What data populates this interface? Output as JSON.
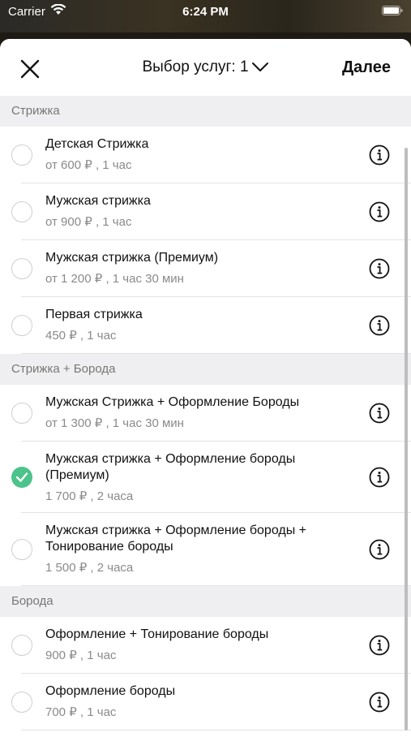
{
  "status_bar": {
    "carrier": "Carrier",
    "time": "6:24 PM"
  },
  "navbar": {
    "title": "Выбор услуг: 1",
    "next_label": "Далее"
  },
  "icons": {
    "close": "close-icon",
    "chevron": "chevron-down-icon",
    "info": "info-icon",
    "check": "checkmark-icon"
  },
  "colors": {
    "accent_green": "#4cc38a",
    "section_bg": "#efeff1",
    "secondary_text": "#8a8a8a"
  },
  "sections": [
    {
      "title": "Стрижка",
      "items": [
        {
          "name": "Детская Стрижка",
          "meta": "от 600 ₽ , 1 час",
          "selected": false
        },
        {
          "name": "Мужская стрижка",
          "meta": "от 900 ₽ , 1 час",
          "selected": false
        },
        {
          "name": "Мужская стрижка (Премиум)",
          "meta": "от 1 200 ₽ , 1 час 30 мин",
          "selected": false
        },
        {
          "name": "Первая стрижка",
          "meta": "450 ₽ , 1 час",
          "selected": false
        }
      ]
    },
    {
      "title": "Стрижка + Борода",
      "items": [
        {
          "name": "Мужская Стрижка + Оформление Бороды",
          "meta": "от 1 300 ₽ , 1 час 30 мин",
          "selected": false
        },
        {
          "name": "Мужская стрижка + Оформление бороды (Премиум)",
          "meta": "1 700 ₽ , 2 часа",
          "selected": true
        },
        {
          "name": "Мужская стрижка + Оформление бороды + Тонирование бороды",
          "meta": "1 500 ₽ , 2 часа",
          "selected": false
        }
      ]
    },
    {
      "title": "Борода",
      "items": [
        {
          "name": "Оформление + Тонирование бороды",
          "meta": "900 ₽ , 1 час",
          "selected": false
        },
        {
          "name": "Оформление бороды",
          "meta": "700 ₽ , 1 час",
          "selected": false
        }
      ]
    }
  ]
}
